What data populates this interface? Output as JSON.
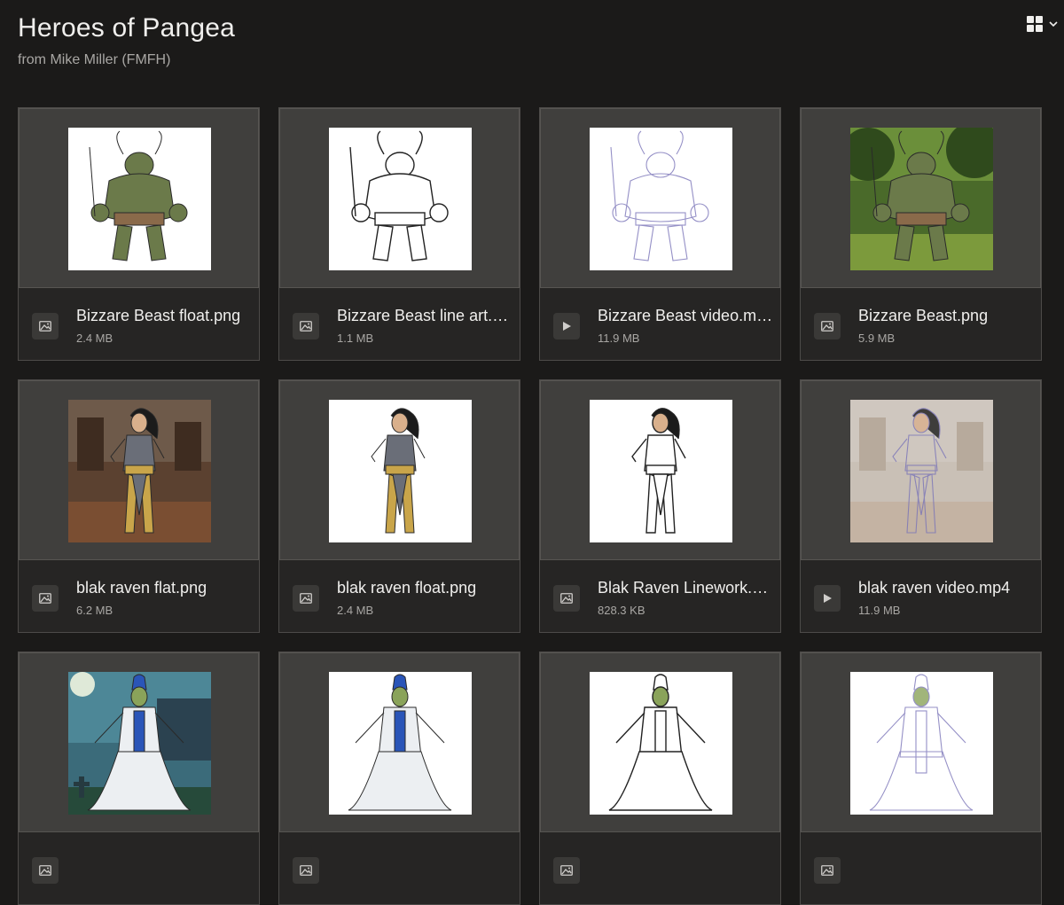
{
  "header": {
    "title": "Heroes of Pangea",
    "subtitle": "from Mike Miller (FMFH)",
    "view_icon": "grid-view-icon"
  },
  "colors": {
    "background": "#1b1a19",
    "card_thumb": "#403f3d",
    "card_meta": "#262524"
  },
  "files": [
    {
      "name": "Bizzare Beast float.png",
      "size": "2.4 MB",
      "kind": "image",
      "art": "beast",
      "bg": "#ffffff",
      "style": "color"
    },
    {
      "name": "Bizzare Beast line art.png",
      "size": "1.1 MB",
      "kind": "image",
      "art": "beast",
      "bg": "#ffffff",
      "style": "line"
    },
    {
      "name": "Bizzare Beast video.mp4",
      "size": "11.9 MB",
      "kind": "video",
      "art": "beast",
      "bg": "#ffffff",
      "style": "sketch"
    },
    {
      "name": "Bizzare Beast.png",
      "size": "5.9 MB",
      "kind": "image",
      "art": "beast",
      "bg": "forest",
      "style": "color"
    },
    {
      "name": "blak raven flat.png",
      "size": "6.2 MB",
      "kind": "image",
      "art": "raven",
      "bg": "room",
      "style": "color"
    },
    {
      "name": "blak raven float.png",
      "size": "2.4 MB",
      "kind": "image",
      "art": "raven",
      "bg": "#ffffff",
      "style": "color"
    },
    {
      "name": "Blak Raven Linework.png",
      "size": "828.3 KB",
      "kind": "image",
      "art": "raven",
      "bg": "#ffffff",
      "style": "line"
    },
    {
      "name": "blak raven video.mp4",
      "size": "11.9 MB",
      "kind": "video",
      "art": "raven",
      "bg": "room-faded",
      "style": "sketch"
    },
    {
      "name": "",
      "size": "",
      "kind": "image",
      "art": "mage",
      "bg": "night",
      "style": "color"
    },
    {
      "name": "",
      "size": "",
      "kind": "image",
      "art": "mage",
      "bg": "#ffffff",
      "style": "color"
    },
    {
      "name": "",
      "size": "",
      "kind": "image",
      "art": "mage",
      "bg": "#ffffff",
      "style": "line"
    },
    {
      "name": "",
      "size": "",
      "kind": "image",
      "art": "mage",
      "bg": "#ffffff",
      "style": "sketch"
    }
  ]
}
